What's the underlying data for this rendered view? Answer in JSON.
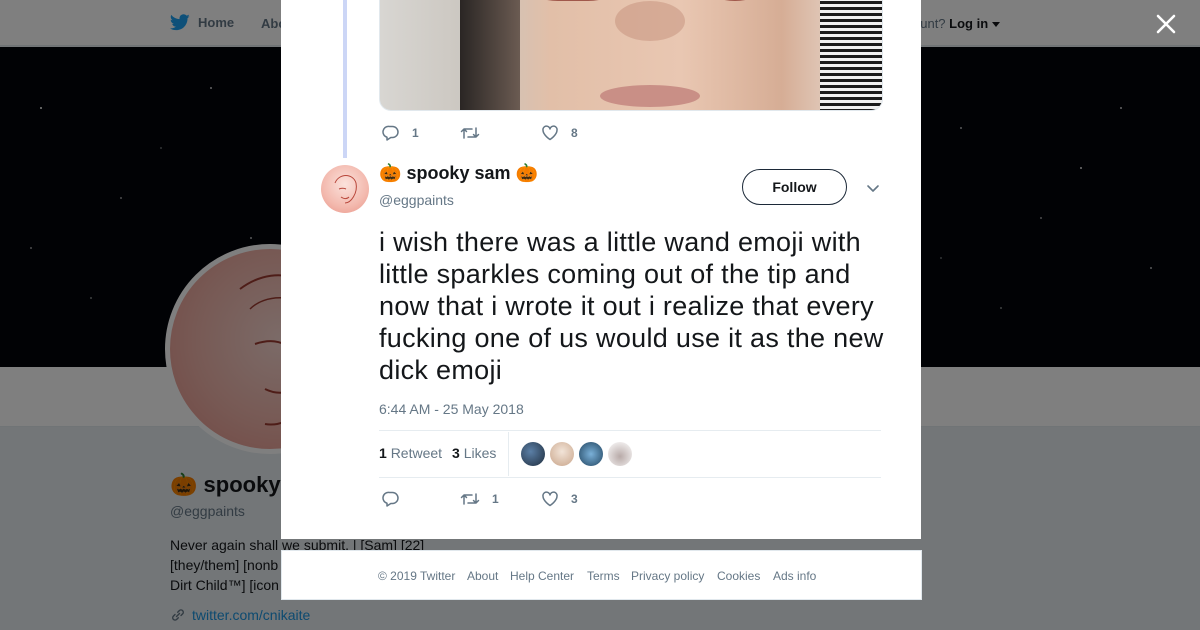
{
  "topnav": {
    "home_label": "Home",
    "about_label": "Abo",
    "account_prompt": "ccount?",
    "login_label": "Log in"
  },
  "profile": {
    "name_text": "spooky",
    "handle": "@eggpaints",
    "bio_lines": [
      "Never again shall we submit. | [Sam] [22]",
      "[they/them] [nonb",
      "Dirt Child™] [icon"
    ],
    "link": "twitter.com/cnikaite",
    "ads_info_partial": "Ads info"
  },
  "previous_tweet": {
    "reply_count": "1",
    "retweet_count": "",
    "like_count": "8"
  },
  "tweet": {
    "emoji": "🎃",
    "display_name": "spooky sam",
    "screen_name": "@eggpaints",
    "follow_label": "Follow",
    "text": "i wish there was a little wand emoji with little sparkles coming out of the tip and now that i wrote it out i realize that every fucking one of us would use it as the new dick emoji",
    "timestamp": "6:44 AM - 25 May 2018",
    "retweet_stat_count": "1",
    "retweet_stat_label": "Retweet",
    "likes_stat_count": "3",
    "likes_stat_label": "Likes",
    "reply_count": "",
    "retweet_count": "1",
    "like_count": "3"
  },
  "footer": {
    "copyright": "© 2019 Twitter",
    "links": [
      "About",
      "Help Center",
      "Terms",
      "Privacy policy",
      "Cookies",
      "Ads info"
    ]
  },
  "colors": {
    "twitter_blue": "#1da1f2",
    "text_primary": "#14171a",
    "text_secondary": "#657786",
    "overlay": "rgba(0,0,0,0.5)"
  },
  "icons": [
    "twitter-bird-icon",
    "caret-down-icon",
    "close-icon",
    "reply-icon",
    "retweet-icon",
    "like-icon",
    "chevron-down-icon",
    "link-icon"
  ]
}
